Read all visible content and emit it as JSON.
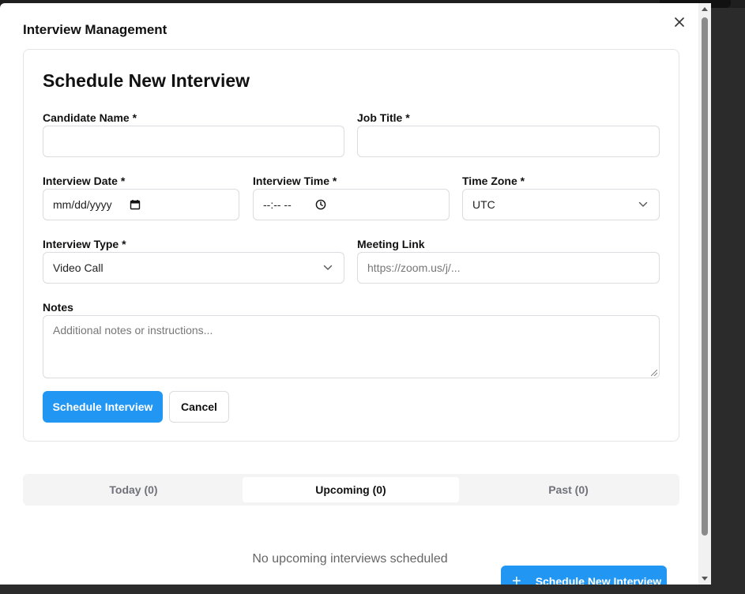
{
  "modal": {
    "title": "Interview Management"
  },
  "form": {
    "title": "Schedule New Interview",
    "candidate_name": {
      "label": "Candidate Name *",
      "value": ""
    },
    "job_title": {
      "label": "Job Title *",
      "value": ""
    },
    "interview_date": {
      "label": "Interview Date *",
      "placeholder": "mm/dd/yyyy"
    },
    "interview_time": {
      "label": "Interview Time *",
      "placeholder": "--:-- --"
    },
    "time_zone": {
      "label": "Time Zone *",
      "value": "UTC"
    },
    "interview_type": {
      "label": "Interview Type *",
      "value": "Video Call"
    },
    "meeting_link": {
      "label": "Meeting Link",
      "placeholder": "https://zoom.us/j/..."
    },
    "notes": {
      "label": "Notes",
      "placeholder": "Additional notes or instructions..."
    },
    "submit_label": "Schedule Interview",
    "cancel_label": "Cancel"
  },
  "tabs": [
    {
      "label": "Today (0)"
    },
    {
      "label": "Upcoming (0)"
    },
    {
      "label": "Past (0)"
    }
  ],
  "active_tab": "Upcoming (0)",
  "empty_state": "No upcoming interviews scheduled",
  "fab": {
    "label": "Schedule New Interview"
  },
  "colors": {
    "primary": "#2196f3",
    "tab_track": "#f4f4f5",
    "border": "#dcdce0"
  },
  "icons": {
    "close": "close-icon",
    "calendar": "calendar-icon",
    "clock": "clock-icon",
    "chevron": "chevron-down-icon",
    "plus": "plus-icon"
  }
}
